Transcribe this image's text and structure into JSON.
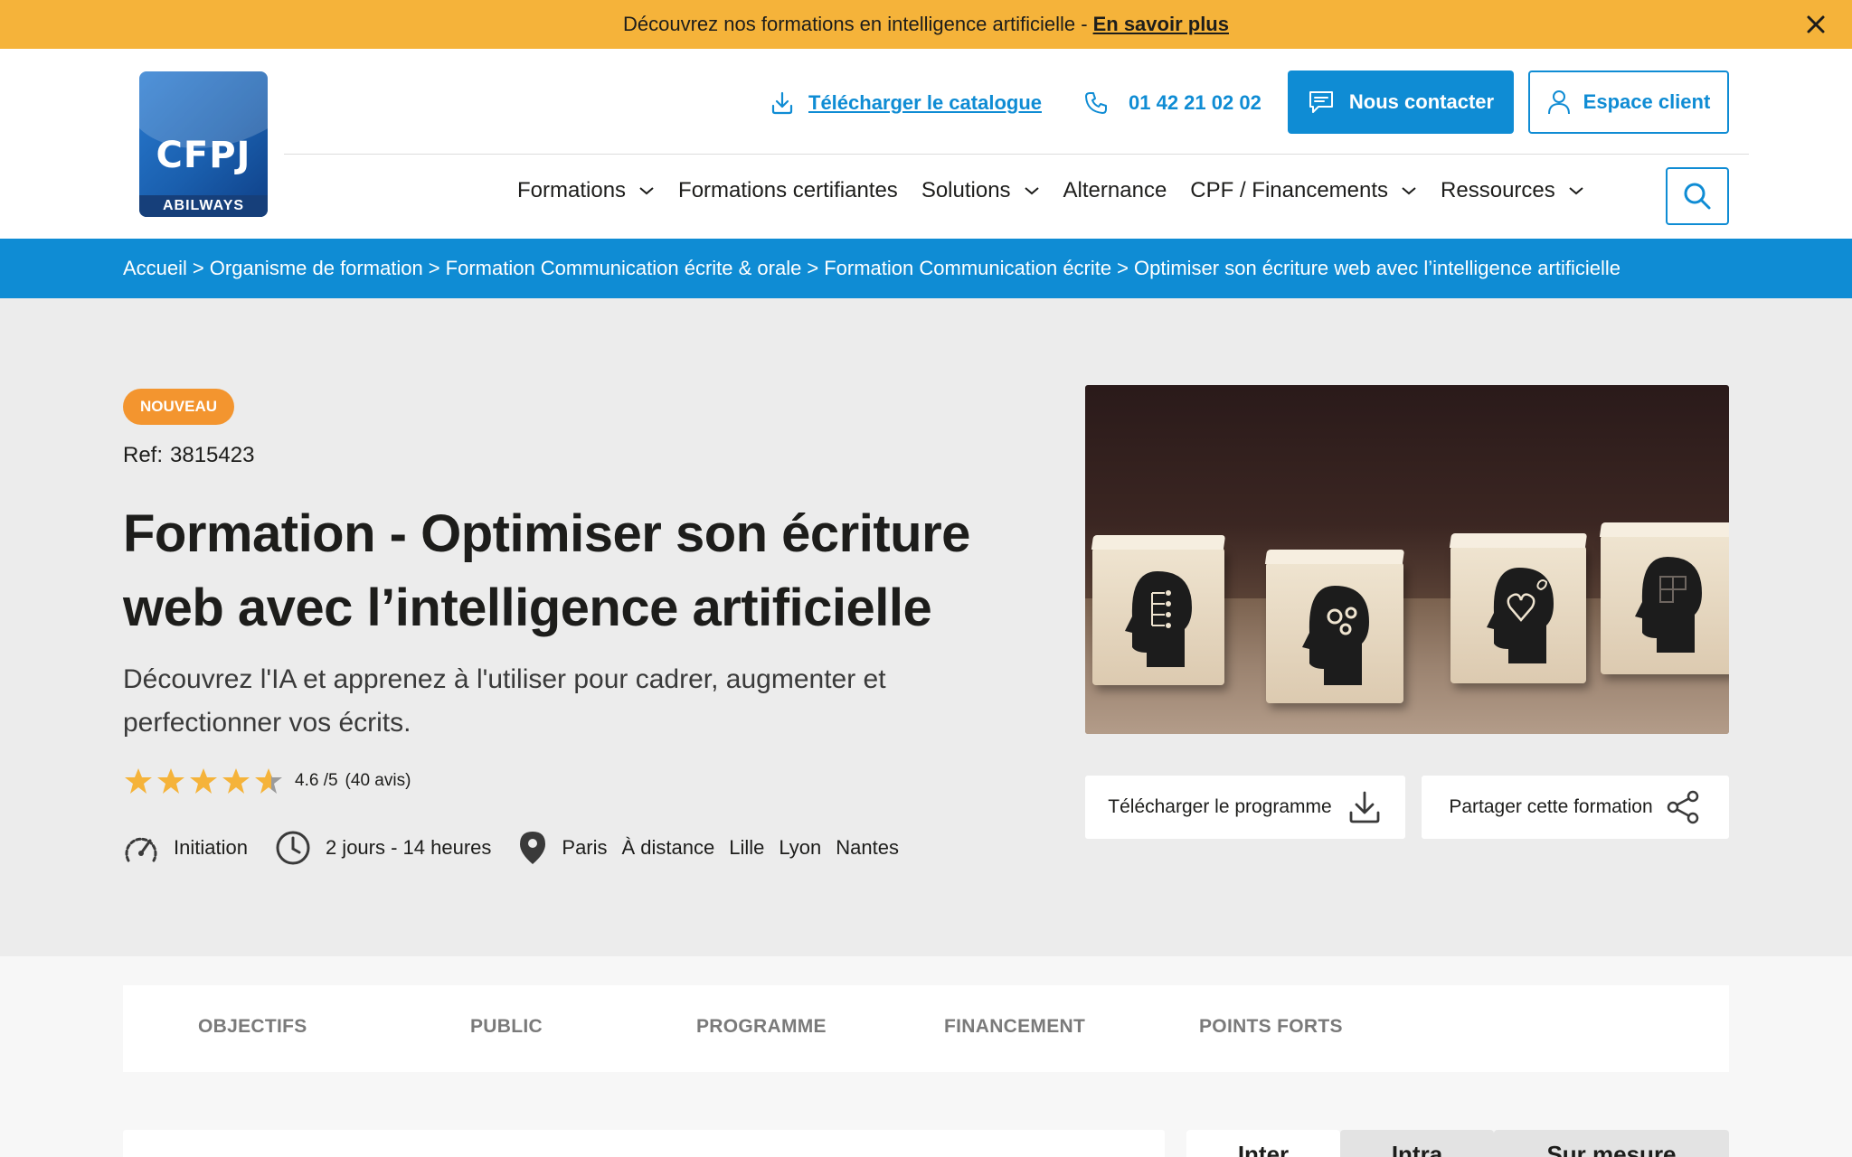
{
  "announcement": {
    "text": "Découvrez nos formations en intelligence artificielle -",
    "link": "En savoir plus"
  },
  "logo": {
    "name": "CFPJ",
    "sub": "ABILWAYS"
  },
  "header": {
    "catalog_label": "Télécharger le catalogue",
    "phone": "01 42 21 02 02",
    "contact_label": "Nous contacter",
    "client_label": "Espace client"
  },
  "nav": {
    "items": [
      {
        "label": "Formations",
        "dropdown": true
      },
      {
        "label": "Formations certifiantes",
        "dropdown": false
      },
      {
        "label": "Solutions",
        "dropdown": true
      },
      {
        "label": "Alternance",
        "dropdown": false
      },
      {
        "label": "CPF / Financements",
        "dropdown": true
      },
      {
        "label": "Ressources",
        "dropdown": true
      }
    ]
  },
  "breadcrumb": [
    "Accueil",
    "Organisme de formation",
    "Formation Communication écrite & orale",
    "Formation Communication écrite",
    "Optimiser son écriture web avec l’intelligence artificielle"
  ],
  "breadcrumb_separator": ">",
  "course": {
    "badge": "NOUVEAU",
    "ref_label": "Ref:",
    "ref_value": "3815423",
    "title": "Formation - Optimiser son écriture web avec l’intelligence artificielle",
    "subtitle": "Découvrez l'IA et apprenez à l'utiliser pour cadrer, augmenter et perfectionner vos écrits.",
    "rating_value": 4.6,
    "rating_text": "4.6 /5",
    "rating_count": "(40 avis)",
    "level": "Initiation",
    "duration": "2 jours - 14 heures",
    "locations": [
      "Paris",
      "À distance",
      "Lille",
      "Lyon",
      "Nantes"
    ],
    "download_label": "Télécharger le programme",
    "share_label": "Partager cette formation"
  },
  "tabs": [
    "OBJECTIFS",
    "PUBLIC",
    "PROGRAMME",
    "FINANCEMENT",
    "POINTS FORTS"
  ],
  "price_tabs": [
    "Inter",
    "Intra",
    "Sur mesure"
  ],
  "colors": {
    "brand_blue": "#0f8cd4",
    "announce_yellow": "#f5b33a",
    "badge_orange": "#f3952f",
    "star": "#f5b33a"
  }
}
